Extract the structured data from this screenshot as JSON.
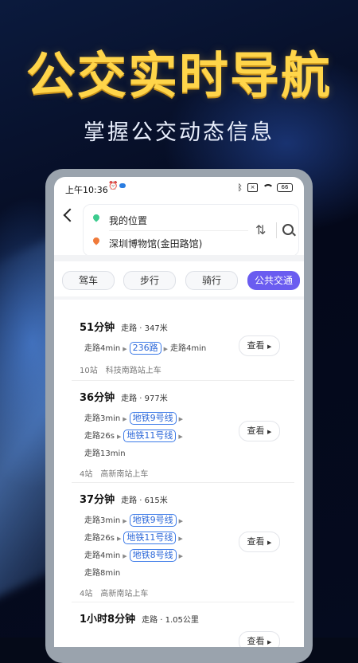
{
  "promo": {
    "headline": "公交实时导航",
    "subline": "掌握公交动态信息"
  },
  "status_bar": {
    "time": "上午10:36",
    "icons": [
      "alarm-off-icon",
      "app-icon",
      "bluetooth-icon",
      "sim-icon",
      "wifi-icon",
      "battery-icon"
    ],
    "battery": "66"
  },
  "search": {
    "origin": "我的位置",
    "destination": "深圳博物馆(金田路馆)"
  },
  "tabs": [
    {
      "label": "驾车",
      "active": false
    },
    {
      "label": "步行",
      "active": false
    },
    {
      "label": "骑行",
      "active": false
    },
    {
      "label": "公共交通",
      "active": true
    }
  ],
  "view_label": "查看",
  "routes": [
    {
      "duration": "51分钟",
      "walk": "走路 · 347米",
      "legs": [
        {
          "pre": "走路4min",
          "line": "236路",
          "post": "走路4min"
        }
      ],
      "stops": "10站",
      "board": "科技南路站上车"
    },
    {
      "duration": "36分钟",
      "walk": "走路 · 977米",
      "legs": [
        {
          "pre": "走路3min",
          "line": "地铁9号线"
        },
        {
          "pre": "走路26s",
          "line": "地铁11号线"
        },
        {
          "pre": "走路13min"
        }
      ],
      "stops": "4站",
      "board": "高新南站上车"
    },
    {
      "duration": "37分钟",
      "walk": "走路 · 615米",
      "legs": [
        {
          "pre": "走路3min",
          "line": "地铁9号线"
        },
        {
          "pre": "走路26s",
          "line": "地铁11号线"
        },
        {
          "pre": "走路4min",
          "line": "地铁8号线"
        },
        {
          "pre": "走路8min"
        }
      ],
      "stops": "4站",
      "board": "高新南站上车"
    },
    {
      "duration": "1小时8分钟",
      "walk": "走路 · 1.05公里"
    }
  ]
}
